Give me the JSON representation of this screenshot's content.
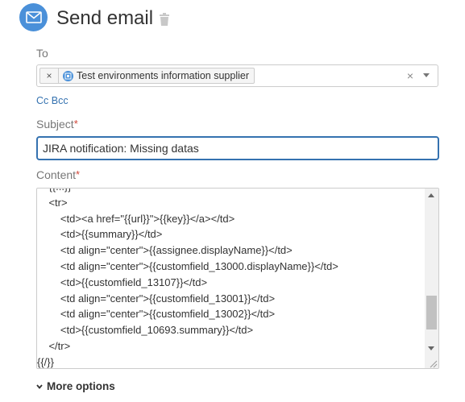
{
  "dialog": {
    "title": "Send email"
  },
  "to_field": {
    "label": "To",
    "recipient": "Test environments information supplier",
    "chip_remove": "×",
    "clear": "×"
  },
  "cc_bcc": {
    "cc": "Cc",
    "bcc": "Bcc"
  },
  "subject": {
    "label": "Subject",
    "required_mark": "*",
    "value": "JIRA notification: Missing datas"
  },
  "content": {
    "label": "Content",
    "required_mark": "*",
    "lines": [
      "    {{...}}",
      "    <tr>",
      "        <td><a href=\"{{url}}\">{{key}}</a></td>",
      "        <td>{{summary}}</td>",
      "        <td align=\"center\">{{assignee.displayName}}</td>",
      "        <td align=\"center\">{{customfield_13000.displayName}}</td>",
      "        <td>{{customfield_13107}}</td>",
      "        <td align=\"center\">{{customfield_13001}}</td>",
      "        <td align=\"center\">{{customfield_13002}}</td>",
      "        <td>{{customfield_10693.summary}}</td>",
      "    </tr>",
      "{{/}}"
    ]
  },
  "more_options": {
    "label": "More options"
  },
  "colors": {
    "accent": "#3572b0",
    "icon_blue": "#4a90d9",
    "required": "#d04437"
  }
}
